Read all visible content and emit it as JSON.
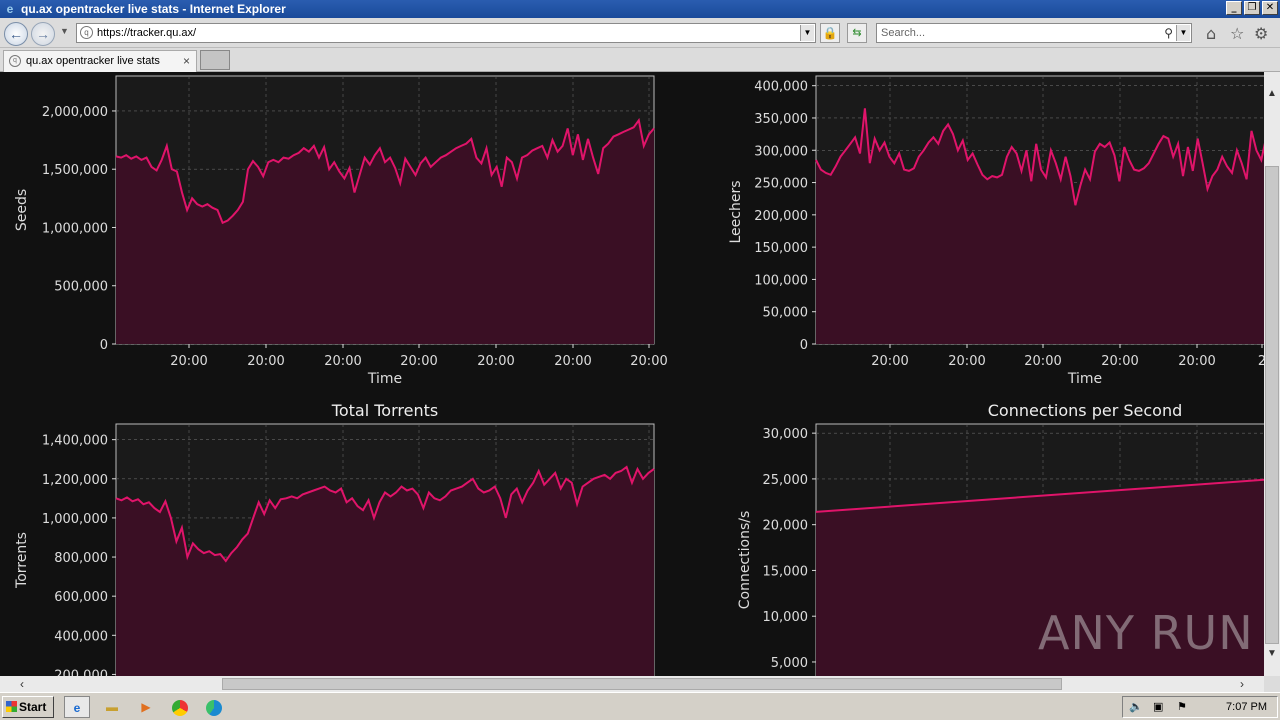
{
  "window": {
    "title": "qu.ax opentracker live stats - Internet Explorer",
    "controls": [
      "_",
      "❐",
      "✕"
    ]
  },
  "navbar": {
    "url": "https://tracker.qu.ax/",
    "search_placeholder": "Search..."
  },
  "tabs": [
    {
      "label": "qu.ax opentracker live stats",
      "close": "×"
    }
  ],
  "charts": {
    "seeds": {
      "title": "",
      "xlabel": "Time",
      "ylabel": "Seeds",
      "yticks": [
        "0",
        "500,000",
        "1,000,000",
        "1,500,000",
        "2,000,000"
      ],
      "xticks": [
        "20:00",
        "20:00",
        "20:00",
        "20:00",
        "20:00",
        "20:00",
        "20:00"
      ]
    },
    "leechers": {
      "title": "",
      "xlabel": "Time",
      "ylabel": "Leechers",
      "yticks": [
        "0",
        "50,000",
        "100,000",
        "150,000",
        "200,000",
        "250,000",
        "300,000",
        "350,000",
        "400,000"
      ],
      "xticks": [
        "20:00",
        "20:00",
        "20:00",
        "20:00",
        "20:00",
        "2"
      ]
    },
    "torrents": {
      "title": "Total Torrents",
      "ylabel": "Torrents",
      "yticks": [
        "200,000",
        "400,000",
        "600,000",
        "800,000",
        "1,000,000",
        "1,200,000",
        "1,400,000"
      ]
    },
    "connections": {
      "title": "Connections per Second",
      "ylabel": "Connections/s",
      "yticks": [
        "5,000",
        "10,000",
        "15,000",
        "20,000",
        "25,000",
        "30,000"
      ]
    }
  },
  "chart_data": [
    {
      "type": "area",
      "ylabel": "Seeds",
      "xlabel": "Time",
      "ylim": [
        0,
        2300000
      ],
      "series": [
        {
          "values": [
            1610000,
            1600000,
            1620000,
            1590000,
            1610000,
            1580000,
            1600000,
            1520000,
            1490000,
            1580000,
            1700000,
            1500000,
            1480000,
            1300000,
            1150000,
            1250000,
            1200000,
            1180000,
            1200000,
            1170000,
            1150000,
            1040000,
            1060000,
            1100000,
            1150000,
            1220000,
            1500000,
            1570000,
            1520000,
            1440000,
            1560000,
            1580000,
            1560000,
            1600000,
            1590000,
            1620000,
            1640000,
            1680000,
            1650000,
            1700000,
            1600000,
            1690000,
            1500000,
            1560000,
            1480000,
            1420000,
            1510000,
            1300000,
            1450000,
            1600000,
            1540000,
            1620000,
            1680000,
            1560000,
            1600000,
            1510000,
            1380000,
            1590000,
            1520000,
            1450000,
            1550000,
            1600000,
            1520000,
            1560000,
            1600000,
            1620000,
            1650000,
            1680000,
            1700000,
            1720000,
            1760000,
            1600000,
            1550000,
            1680000,
            1450000,
            1520000,
            1350000,
            1600000,
            1560000,
            1420000,
            1600000,
            1620000,
            1660000,
            1680000,
            1700000,
            1600000,
            1750000,
            1650000,
            1700000,
            1850000,
            1620000,
            1800000,
            1580000,
            1760000,
            1600000,
            1460000,
            1680000,
            1720000,
            1780000,
            1800000,
            1820000,
            1840000,
            1860000,
            1920000,
            1700000,
            1800000,
            1850000
          ]
        }
      ]
    },
    {
      "type": "area",
      "ylabel": "Leechers",
      "xlabel": "Time",
      "ylim": [
        0,
        415000
      ],
      "series": [
        {
          "values": [
            285000,
            270000,
            265000,
            262000,
            275000,
            290000,
            300000,
            310000,
            320000,
            295000,
            365000,
            280000,
            318000,
            300000,
            312000,
            290000,
            280000,
            295000,
            270000,
            268000,
            272000,
            290000,
            300000,
            312000,
            320000,
            310000,
            330000,
            340000,
            325000,
            300000,
            315000,
            285000,
            295000,
            278000,
            262000,
            255000,
            260000,
            258000,
            262000,
            290000,
            305000,
            295000,
            268000,
            300000,
            252000,
            310000,
            270000,
            258000,
            300000,
            280000,
            255000,
            290000,
            260000,
            215000,
            245000,
            270000,
            255000,
            298000,
            310000,
            305000,
            312000,
            292000,
            252000,
            305000,
            285000,
            270000,
            268000,
            272000,
            280000,
            295000,
            310000,
            322000,
            318000,
            290000,
            310000,
            260000,
            305000,
            268000,
            318000,
            280000,
            240000,
            260000,
            270000,
            290000,
            275000,
            265000,
            300000,
            280000,
            255000,
            330000,
            300000,
            285000,
            320000,
            305000,
            295000
          ]
        }
      ]
    },
    {
      "type": "area",
      "title": "Total Torrents",
      "ylabel": "Torrents",
      "ylim": [
        100000,
        1480000
      ],
      "series": [
        {
          "values": [
            1100000,
            1090000,
            1105000,
            1085000,
            1095000,
            1070000,
            1080000,
            1050000,
            1030000,
            1085000,
            1000000,
            880000,
            950000,
            800000,
            870000,
            840000,
            820000,
            830000,
            810000,
            815000,
            780000,
            820000,
            850000,
            890000,
            920000,
            1000000,
            1080000,
            1020000,
            1090000,
            1050000,
            1095000,
            1100000,
            1110000,
            1100000,
            1120000,
            1130000,
            1140000,
            1150000,
            1160000,
            1140000,
            1130000,
            1150000,
            1080000,
            1100000,
            1060000,
            1040000,
            1090000,
            1000000,
            1080000,
            1130000,
            1110000,
            1130000,
            1160000,
            1140000,
            1150000,
            1120000,
            1050000,
            1130000,
            1100000,
            1090000,
            1110000,
            1140000,
            1150000,
            1160000,
            1180000,
            1200000,
            1150000,
            1130000,
            1140000,
            1160000,
            1100000,
            1000000,
            1120000,
            1150000,
            1080000,
            1140000,
            1180000,
            1240000,
            1170000,
            1200000,
            1230000,
            1150000,
            1200000,
            1180000,
            1070000,
            1160000,
            1180000,
            1200000,
            1210000,
            1220000,
            1200000,
            1230000,
            1240000,
            1260000,
            1180000,
            1250000,
            1200000,
            1230000,
            1250000
          ]
        }
      ]
    },
    {
      "type": "area",
      "title": "Connections per Second",
      "ylabel": "Connections/s",
      "ylim": [
        1500,
        31000
      ],
      "series": [
        {
          "values": [
            21400,
            25000
          ]
        }
      ]
    }
  ],
  "watermark": "ANY RUN",
  "taskbar": {
    "start": "Start",
    "clock": "7:07 PM"
  }
}
